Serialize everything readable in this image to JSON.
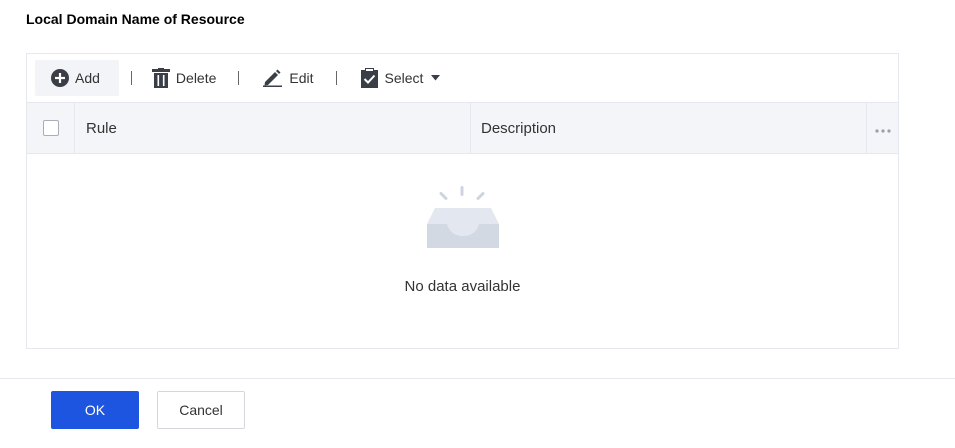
{
  "section": {
    "title": "Local Domain Name of Resource"
  },
  "toolbar": {
    "add_label": "Add",
    "delete_label": "Delete",
    "edit_label": "Edit",
    "select_label": "Select",
    "add_icon": "plus-circle-icon",
    "delete_icon": "trash-icon",
    "edit_icon": "pencil-icon",
    "select_icon": "checked-doc-icon"
  },
  "table": {
    "columns": [
      "Rule",
      "Description"
    ],
    "empty_text": "No data available",
    "rows": []
  },
  "footer": {
    "ok_label": "OK",
    "cancel_label": "Cancel"
  },
  "colors": {
    "primary": "#1d55e0",
    "header_bg": "#f3f5f8",
    "border": "#e5e8ee"
  }
}
